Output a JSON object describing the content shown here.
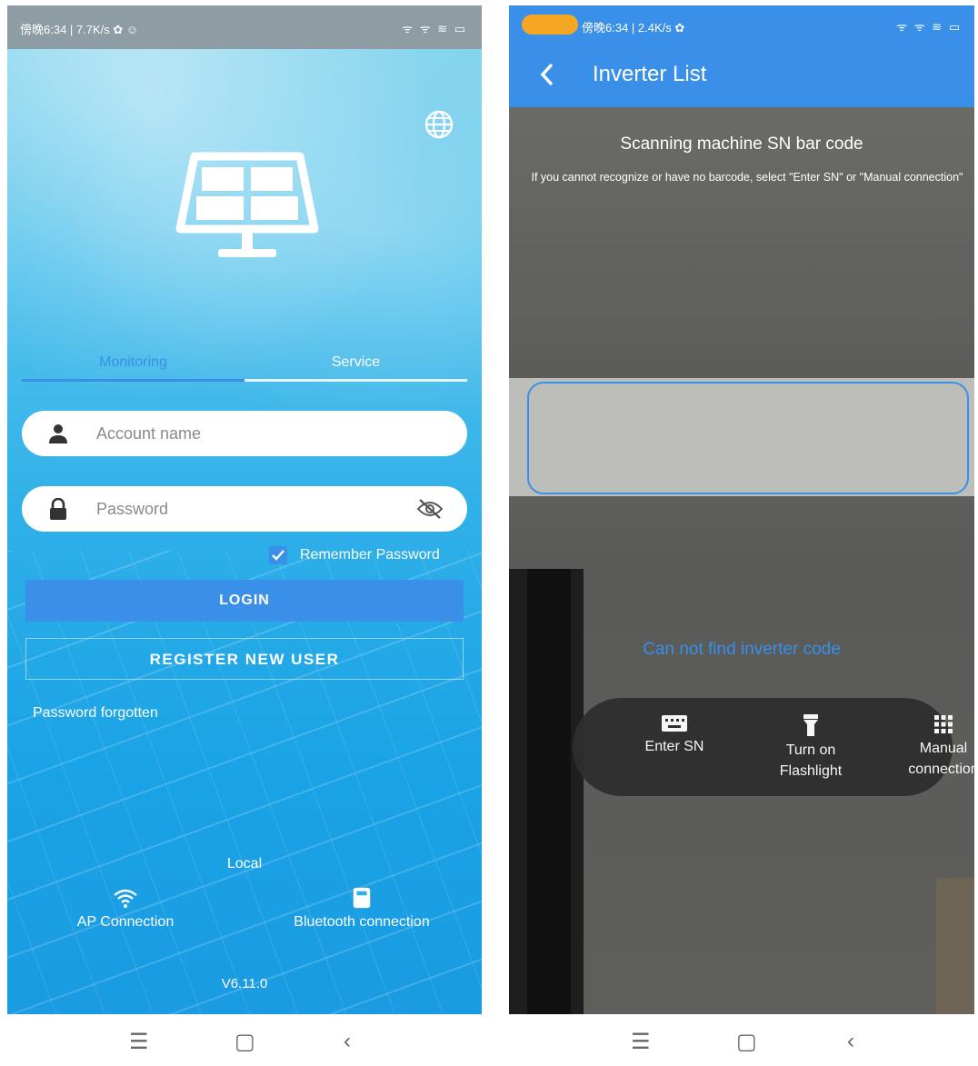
{
  "left_screen": {
    "status": {
      "time": "傍晚6:34 | 7.7K/s ✿ ☺",
      "icons": "ᯤ ᯤ ≋ ▭"
    },
    "tabs": [
      {
        "label": "Monitoring"
      },
      {
        "label": "Service"
      }
    ],
    "account_placeholder": "Account name",
    "password_placeholder": "Password",
    "remember_label": "Remember Password",
    "remember_checked": true,
    "login_label": "LOGIN",
    "register_label": "REGISTER NEW USER",
    "forgot_label": "Password forgotten",
    "local_label": "Local",
    "ap_label": "AP Connection",
    "bt_label": "Bluetooth connection",
    "version": "V6.11.0"
  },
  "right_screen": {
    "status": {
      "time": "傍晚6:34 | 2.4K/s ✿",
      "icons": "ᯤ ᯤ ≋ ▭"
    },
    "title": "Inverter List",
    "scan_title": "Scanning machine SN bar code",
    "scan_hint": "If you cannot recognize or have no barcode, select \"Enter SN\" or \"Manual connection\"",
    "not_find": "Can not find inverter code",
    "actions": [
      {
        "label": "Enter SN",
        "icon": "keyboard-icon"
      },
      {
        "label": "Turn on\nFlashlight",
        "icon": "flashlight-icon"
      },
      {
        "label": "Manual\nconnection",
        "icon": "grid-icon"
      }
    ]
  },
  "navbar": {
    "menu": "☰",
    "home": "▢",
    "back": "‹"
  },
  "colors": {
    "accent": "#3a8fe8",
    "sky": "#30b0e8",
    "bar": "#2e2e2e"
  }
}
